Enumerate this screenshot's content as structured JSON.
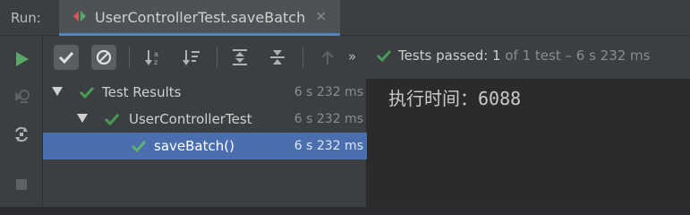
{
  "run_label": "Run:",
  "tab": {
    "label": "UserControllerTest.saveBatch",
    "close_glyph": "×"
  },
  "toolbar": {
    "more_glyph": "»",
    "status_passed": "Tests passed: 1",
    "status_rest": "of 1 test – 6 s 232 ms"
  },
  "tree": {
    "rows": [
      {
        "label": "Test Results",
        "time": "6 s 232 ms"
      },
      {
        "label": "UserControllerTest",
        "time": "6 s 232 ms"
      },
      {
        "label": "saveBatch()",
        "time": "6 s 232 ms"
      }
    ]
  },
  "console": {
    "output": "执行时间：6088"
  },
  "colors": {
    "accent": "#4a88c7",
    "pass_green": "#499c54",
    "selection": "#4b6eaf"
  }
}
